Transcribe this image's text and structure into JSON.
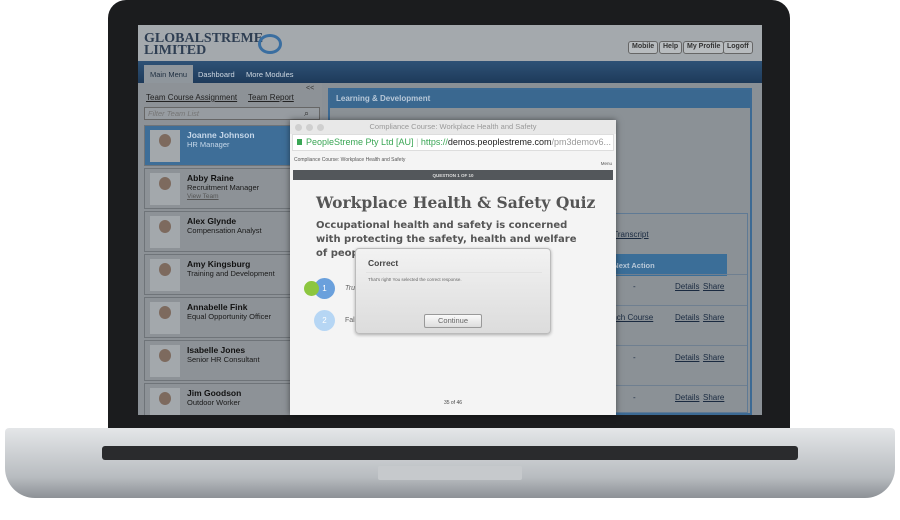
{
  "app": {
    "logo_line1": "GLOBALSTREME",
    "logo_line2": "LIMITED",
    "top_buttons": [
      "Mobile",
      "Help",
      "My Profile",
      "Logoff"
    ]
  },
  "nav": {
    "tabs": [
      "Main Menu",
      "Dashboard",
      "More Modules"
    ],
    "active": "Main Menu"
  },
  "sidebar": {
    "links": [
      "Team Course Assignment",
      "Team Report"
    ],
    "collapse": "<<",
    "filter_placeholder": "Filter Team List",
    "people": [
      {
        "name": "Joanne Johnson",
        "role": "HR Manager",
        "selected": true
      },
      {
        "name": "Abby Raine",
        "role": "Recruitment Manager",
        "link": "View Team"
      },
      {
        "name": "Alex Glynde",
        "role": "Compensation Analyst"
      },
      {
        "name": "Amy Kingsburg",
        "role": "Training and Development"
      },
      {
        "name": "Annabelle Fink",
        "role": "Equal Opportunity Officer"
      },
      {
        "name": "Isabelle Jones",
        "role": "Senior HR Consultant"
      },
      {
        "name": "Jim Goodson",
        "role": "Outdoor Worker"
      }
    ]
  },
  "main": {
    "panel_title": "Learning & Development",
    "transcript_link": "t Transcript",
    "table_header": "Next Action",
    "rows": [
      {
        "next": "-",
        "details": "Details",
        "share": "Share"
      },
      {
        "next": "Launch Course",
        "details": "Details",
        "share": "Share"
      },
      {
        "next": "-",
        "details": "Details",
        "share": "Share"
      },
      {
        "next": "-",
        "details": "Details",
        "share": "Share"
      }
    ]
  },
  "popup": {
    "window_title": "Compliance Course: Workplace Health and Safety",
    "site_identity": "PeopleStreme Pty Ltd [AU]",
    "url_scheme": "https://",
    "url_host": "demos.peoplestreme.com",
    "url_path": "/pm3demov6...",
    "course_header": "Compliance Course: Workplace Health and Safety",
    "menu": "Menu",
    "question_bar": "QUESTION 1 OF 10",
    "quiz_title": "Workplace Health & Safety Quiz",
    "question": "Occupational health and safety is concerned with protecting the safety, health and welfare of people engaged",
    "options": [
      {
        "num": "1",
        "label": "Tru"
      },
      {
        "num": "2",
        "label": "Fals"
      }
    ],
    "page": "35 of 46",
    "dialog": {
      "title": "Correct",
      "message": "That's right! You selected the correct response.",
      "button": "Continue"
    }
  },
  "colors": {
    "accent": "#3a6890",
    "selected_option": "#6aa0dc",
    "correct_dot": "#8cc63f",
    "secure": "#3aa655"
  }
}
